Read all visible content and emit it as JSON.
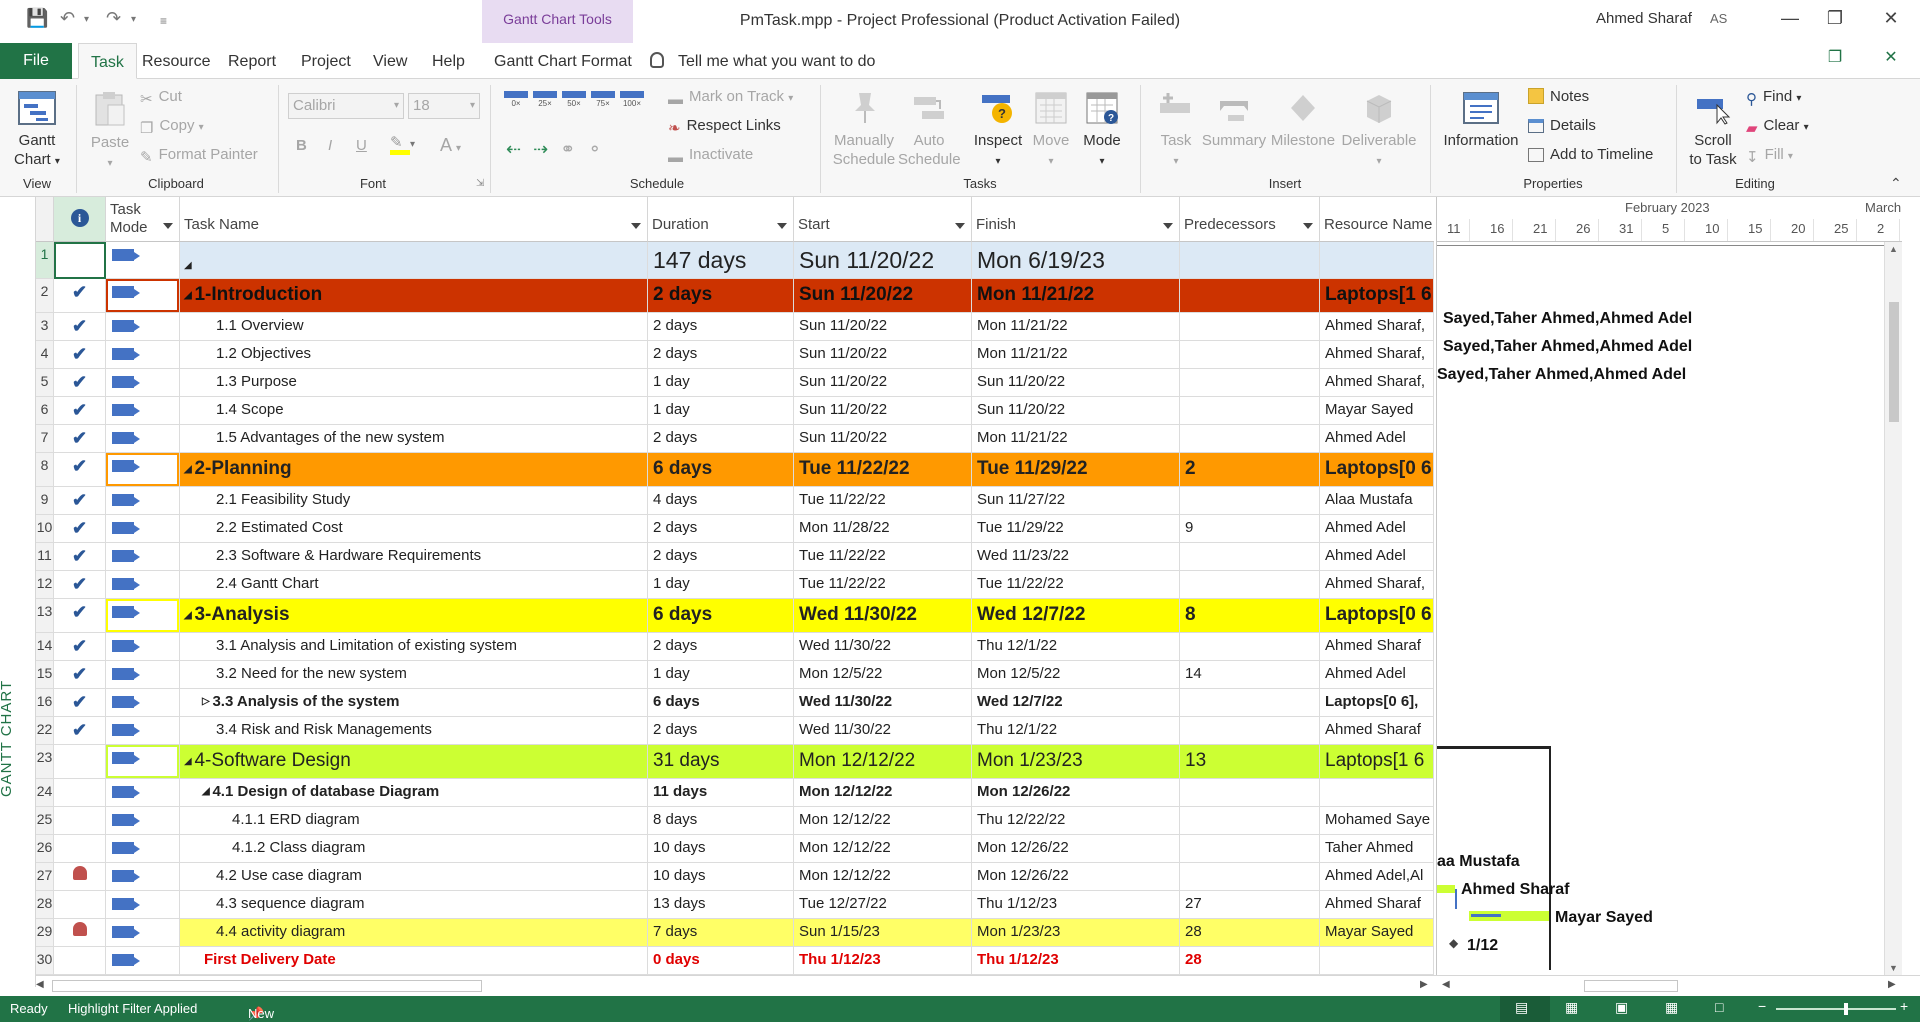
{
  "title_bar": {
    "context_tab_group": "Gantt Chart Tools",
    "document_title": "PmTask.mpp  -  Project Professional (Product Activation Failed)",
    "user_name": "Ahmed Sharaf",
    "user_initials": "AS"
  },
  "tabs": {
    "file": "File",
    "task": "Task",
    "resource": "Resource",
    "report": "Report",
    "project": "Project",
    "view": "View",
    "help": "Help",
    "format": "Gantt Chart Format",
    "tell_me": "Tell me what you want to do"
  },
  "ribbon": {
    "view_group": {
      "gantt_line1": "Gantt",
      "gantt_line2": "Chart",
      "label": "View"
    },
    "clipboard": {
      "paste": "Paste",
      "cut": "Cut",
      "copy": "Copy",
      "format_painter": "Format Painter",
      "label": "Clipboard"
    },
    "font": {
      "family": "Calibri",
      "size": "18",
      "bold": "B",
      "italic": "I",
      "underline": "U",
      "font_color": "A",
      "label": "Font"
    },
    "schedule": {
      "pct0": "0×",
      "pct25": "25×",
      "pct50": "50×",
      "pct75": "75×",
      "pct100": "100×",
      "mark_on_track": "Mark on Track",
      "respect_links": "Respect Links",
      "inactivate": "Inactivate",
      "label": "Schedule"
    },
    "tasks": {
      "manually1": "Manually",
      "manually2": "Schedule",
      "auto1": "Auto",
      "auto2": "Schedule",
      "inspect": "Inspect",
      "move": "Move",
      "mode": "Mode",
      "label": "Tasks"
    },
    "insert": {
      "task": "Task",
      "summary": "Summary",
      "milestone": "Milestone",
      "deliverable": "Deliverable",
      "label": "Insert"
    },
    "properties": {
      "information": "Information",
      "notes": "Notes",
      "details": "Details",
      "add_to_timeline": "Add to Timeline",
      "label": "Properties"
    },
    "editing": {
      "scroll1": "Scroll",
      "scroll2": "to Task",
      "find": "Find",
      "clear": "Clear",
      "fill": "Fill",
      "label": "Editing"
    }
  },
  "view_bar": {
    "label": "GANTT CHART"
  },
  "table": {
    "headers": {
      "indicators_icon": "info-icon",
      "task_mode_line1": "Task",
      "task_mode_line2": "Mode",
      "task_name": "Task Name",
      "duration": "Duration",
      "start": "Start",
      "finish": "Finish",
      "predecessors": "Predecessors",
      "resource_names": "Resource Name"
    },
    "rows": [
      {
        "id": "1",
        "done": false,
        "indicator": "",
        "name": "",
        "duration": "147 days",
        "start": "Sun 11/20/22",
        "finish": "Mon 6/19/23",
        "pred": "",
        "res": "",
        "style": "project"
      },
      {
        "id": "2",
        "done": true,
        "indicator": "",
        "name": "1-Introduction",
        "duration": "2 days",
        "start": "Sun 11/20/22",
        "finish": "Mon 11/21/22",
        "pred": "",
        "res": "Laptops[1 6",
        "style": "phase",
        "bg": "#cc3300",
        "outline": "collapse"
      },
      {
        "id": "3",
        "done": true,
        "indicator": "",
        "name": "1.1 Overview",
        "duration": "2 days",
        "start": "Sun 11/20/22",
        "finish": "Mon 11/21/22",
        "pred": "",
        "res": "Ahmed Sharaf,",
        "style": "task1"
      },
      {
        "id": "4",
        "done": true,
        "indicator": "",
        "name": "1.2 Objectives",
        "duration": "2 days",
        "start": "Sun 11/20/22",
        "finish": "Mon 11/21/22",
        "pred": "",
        "res": "Ahmed Sharaf,",
        "style": "task1"
      },
      {
        "id": "5",
        "done": true,
        "indicator": "",
        "name": "1.3 Purpose",
        "duration": "1 day",
        "start": "Sun 11/20/22",
        "finish": "Sun 11/20/22",
        "pred": "",
        "res": "Ahmed Sharaf,",
        "style": "task1"
      },
      {
        "id": "6",
        "done": true,
        "indicator": "",
        "name": "1.4 Scope",
        "duration": "1 day",
        "start": "Sun 11/20/22",
        "finish": "Sun 11/20/22",
        "pred": "",
        "res": "Mayar Sayed",
        "style": "task1"
      },
      {
        "id": "7",
        "done": true,
        "indicator": "",
        "name": "1.5 Advantages of the new system",
        "duration": "2 days",
        "start": "Sun 11/20/22",
        "finish": "Mon 11/21/22",
        "pred": "",
        "res": "Ahmed Adel",
        "style": "task1"
      },
      {
        "id": "8",
        "done": true,
        "indicator": "",
        "name": "2-Planning",
        "duration": "6 days",
        "start": "Tue 11/22/22",
        "finish": "Tue 11/29/22",
        "pred": "2",
        "res": "Laptops[0 6",
        "style": "phase",
        "bg": "#ff9900",
        "outline": "collapse"
      },
      {
        "id": "9",
        "done": true,
        "indicator": "",
        "name": "2.1 Feasibility Study",
        "duration": "4 days",
        "start": "Tue 11/22/22",
        "finish": "Sun 11/27/22",
        "pred": "",
        "res": "Alaa Mustafa",
        "style": "task1"
      },
      {
        "id": "10",
        "done": true,
        "indicator": "",
        "name": "2.2 Estimated Cost",
        "duration": "2 days",
        "start": "Mon 11/28/22",
        "finish": "Tue 11/29/22",
        "pred": "9",
        "res": "Ahmed Adel",
        "style": "task1"
      },
      {
        "id": "11",
        "done": true,
        "indicator": "",
        "name": "2.3 Software & Hardware Requirements",
        "duration": "2 days",
        "start": "Tue 11/22/22",
        "finish": "Wed 11/23/22",
        "pred": "",
        "res": "Ahmed Adel",
        "style": "task1"
      },
      {
        "id": "12",
        "done": true,
        "indicator": "",
        "name": "2.4 Gantt Chart",
        "duration": "1 day",
        "start": "Tue 11/22/22",
        "finish": "Tue 11/22/22",
        "pred": "",
        "res": "Ahmed Sharaf,",
        "style": "task1"
      },
      {
        "id": "13",
        "done": true,
        "indicator": "",
        "name": "3-Analysis",
        "duration": "6 days",
        "start": "Wed 11/30/22",
        "finish": "Wed 12/7/22",
        "pred": "8",
        "res": "Laptops[0 6",
        "style": "phase",
        "bg": "#ffff00",
        "outline": "collapse"
      },
      {
        "id": "14",
        "done": true,
        "indicator": "",
        "name": "3.1 Analysis and Limitation of existing system",
        "duration": "2 days",
        "start": "Wed 11/30/22",
        "finish": "Thu 12/1/22",
        "pred": "",
        "res": "Ahmed Sharaf",
        "style": "task1"
      },
      {
        "id": "15",
        "done": true,
        "indicator": "",
        "name": "3.2 Need for the new system",
        "duration": "1 day",
        "start": "Mon 12/5/22",
        "finish": "Mon 12/5/22",
        "pred": "14",
        "res": "Ahmed Adel",
        "style": "task1"
      },
      {
        "id": "16",
        "done": true,
        "indicator": "",
        "name": "3.3 Analysis of the system",
        "duration": "6 days",
        "start": "Wed 11/30/22",
        "finish": "Wed 12/7/22",
        "pred": "",
        "res": "Laptops[0 6],",
        "style": "sub",
        "outline": "expand"
      },
      {
        "id": "22",
        "done": true,
        "indicator": "",
        "name": "3.4 Risk and Risk Managements",
        "duration": "2 days",
        "start": "Wed 11/30/22",
        "finish": "Thu 12/1/22",
        "pred": "",
        "res": "Ahmed Sharaf",
        "style": "task1"
      },
      {
        "id": "23",
        "done": false,
        "indicator": "",
        "name": "4-Software Design",
        "duration": "31 days",
        "start": "Mon 12/12/22",
        "finish": "Mon 1/23/23",
        "pred": "13",
        "res": "Laptops[1 6",
        "style": "phase2",
        "bg": "#ccff33",
        "outline": "collapse"
      },
      {
        "id": "24",
        "done": false,
        "indicator": "",
        "name": "4.1 Design of database Diagram",
        "duration": "11 days",
        "start": "Mon 12/12/22",
        "finish": "Mon 12/26/22",
        "pred": "",
        "res": "",
        "style": "sub",
        "outline": "collapse"
      },
      {
        "id": "25",
        "done": false,
        "indicator": "",
        "name": "4.1.1 ERD diagram",
        "duration": "8 days",
        "start": "Mon 12/12/22",
        "finish": "Thu 12/22/22",
        "pred": "",
        "res": "Mohamed Saye",
        "style": "task2"
      },
      {
        "id": "26",
        "done": false,
        "indicator": "",
        "name": "4.1.2 Class diagram",
        "duration": "10 days",
        "start": "Mon 12/12/22",
        "finish": "Mon 12/26/22",
        "pred": "",
        "res": "Taher Ahmed",
        "style": "task2"
      },
      {
        "id": "27",
        "done": false,
        "indicator": "person",
        "name": "4.2 Use case diagram",
        "duration": "10 days",
        "start": "Mon 12/12/22",
        "finish": "Mon 12/26/22",
        "pred": "",
        "res": "Ahmed Adel,Al",
        "style": "task1"
      },
      {
        "id": "28",
        "done": false,
        "indicator": "",
        "name": "4.3 sequence diagram",
        "duration": "13 days",
        "start": "Tue 12/27/22",
        "finish": "Thu 1/12/23",
        "pred": "27",
        "res": "Ahmed Sharaf",
        "style": "task1"
      },
      {
        "id": "29",
        "done": false,
        "indicator": "person",
        "name": "4.4 activity diagram",
        "duration": "7 days",
        "start": "Sun 1/15/23",
        "finish": "Mon 1/23/23",
        "pred": "28",
        "res": "Mayar Sayed",
        "style": "task1",
        "bg": "#ffff66"
      },
      {
        "id": "30",
        "done": false,
        "indicator": "",
        "name": "First Delivery Date",
        "duration": "0 days",
        "start": "Thu 1/12/23",
        "finish": "Thu 1/12/23",
        "pred": "28",
        "res": "",
        "style": "milestone"
      }
    ]
  },
  "gantt": {
    "month1": "February 2023",
    "month2": "March",
    "ticks": [
      "11",
      "16",
      "21",
      "26",
      "31",
      "5",
      "10",
      "15",
      "20",
      "25",
      "2"
    ],
    "labels": {
      "r3": "Sayed,Taher Ahmed,Ahmed Adel",
      "r4": "Sayed,Taher Ahmed,Ahmed Adel",
      "r5": "Sayed,Taher Ahmed,Ahmed Adel",
      "r27": "aa Mustafa",
      "r28": "Ahmed Sharaf",
      "r29": "Mayar Sayed",
      "r30": "1/12"
    },
    "bar_color": "#ccff33"
  },
  "status_bar": {
    "ready": "Ready",
    "filter": "Highlight Filter Applied",
    "new_tasks": "New Tasks : Manually Scheduled"
  }
}
